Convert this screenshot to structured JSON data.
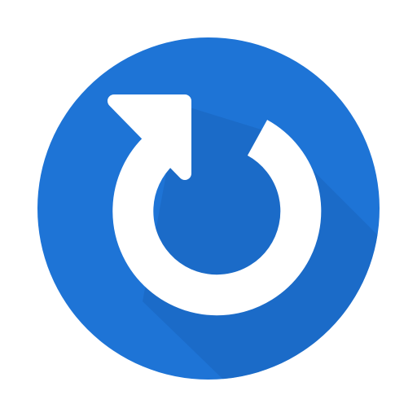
{
  "icon": {
    "name": "refresh-icon",
    "colors": {
      "background": "#ffffff",
      "circle": "#1e74d6",
      "shadow": "#1a64bd",
      "glyph": "#ffffff"
    }
  }
}
